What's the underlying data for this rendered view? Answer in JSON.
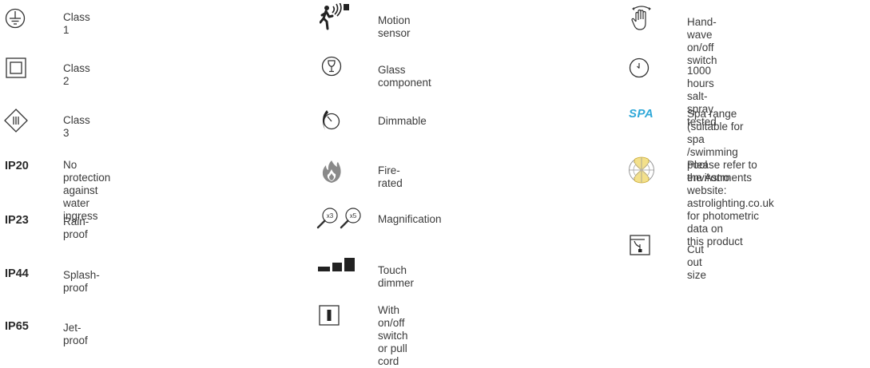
{
  "column1": {
    "items": [
      {
        "icon": "earth-ground-icon",
        "label": "Class 1"
      },
      {
        "icon": "double-square-icon",
        "label": "Class 2"
      },
      {
        "icon": "diamond-iii-icon",
        "label": "Class 3"
      },
      {
        "code": "IP20",
        "label": "No protection against\nwater ingress"
      },
      {
        "code": "IP23",
        "label": "Rain-proof"
      },
      {
        "code": "IP44",
        "label": "Splash-proof"
      },
      {
        "code": "IP65",
        "label": "Jet-proof"
      }
    ]
  },
  "column2": {
    "items": [
      {
        "icon": "motion-sensor-icon",
        "label": "Motion sensor"
      },
      {
        "icon": "wine-glass-icon",
        "label": "Glass component"
      },
      {
        "icon": "dimmable-icon",
        "label": "Dimmable"
      },
      {
        "icon": "flame-icon",
        "label": "Fire-rated"
      },
      {
        "icon": "magnifier-icon",
        "label": "Magnification",
        "marks": [
          "x3",
          "x5"
        ]
      },
      {
        "icon": "touch-dimmer-icon",
        "label": "Touch dimmer"
      },
      {
        "icon": "switch-icon",
        "label": "With on/off switch\nor pull cord"
      }
    ]
  },
  "column3": {
    "items": [
      {
        "icon": "hand-wave-icon",
        "label": "Hand-wave on/off switch"
      },
      {
        "icon": "clock-icon",
        "label": "1000 hours salt-spray tested"
      },
      {
        "badge": "SPA",
        "label": "Spa range (suitable for spa\n/swimming pool environments"
      },
      {
        "icon": "photometric-icon",
        "label": "Please refer to the Astro\nwebsite: astrolighting.co.uk\nfor photometric data on\nthis product"
      },
      {
        "icon": "cutout-size-icon",
        "label": "Cut out size"
      }
    ]
  },
  "colors": {
    "text": "#3a3a3a",
    "icon": "#333333",
    "spa_badge": "#2fa8d8",
    "photometric_fill": "#f3e08a"
  }
}
